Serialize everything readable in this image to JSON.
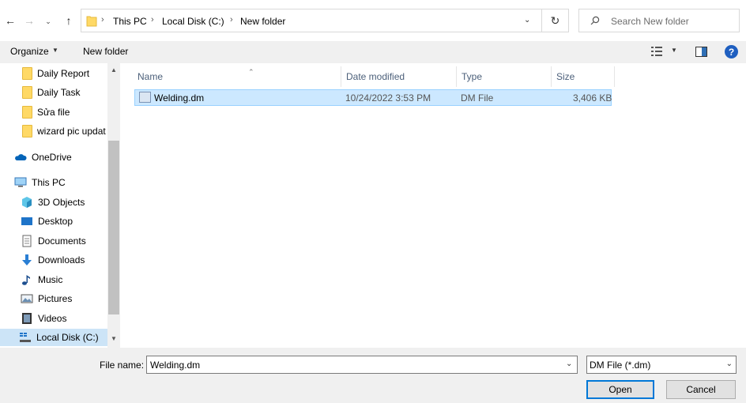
{
  "address_bar": {
    "crumbs": [
      "This PC",
      "Local Disk (C:)",
      "New folder"
    ],
    "search_placeholder": "Search New folder"
  },
  "command_bar": {
    "organize_label": "Organize",
    "new_folder_label": "New folder"
  },
  "nav_pane": {
    "items": [
      {
        "label": "Daily Report",
        "icon": "folder-icon"
      },
      {
        "label": "Daily Task",
        "icon": "folder-icon"
      },
      {
        "label": "Sửa file",
        "icon": "folder-icon"
      },
      {
        "label": "wizard pic updat",
        "icon": "folder-icon"
      },
      {
        "label": "OneDrive",
        "icon": "cloud-icon"
      },
      {
        "label": "This PC",
        "icon": "computer-icon"
      },
      {
        "label": "3D Objects",
        "icon": "cube-icon"
      },
      {
        "label": "Desktop",
        "icon": "desktop-icon"
      },
      {
        "label": "Documents",
        "icon": "document-icon"
      },
      {
        "label": "Downloads",
        "icon": "download-icon"
      },
      {
        "label": "Music",
        "icon": "music-icon"
      },
      {
        "label": "Pictures",
        "icon": "pictures-icon"
      },
      {
        "label": "Videos",
        "icon": "videos-icon"
      },
      {
        "label": "Local Disk (C:)",
        "icon": "drive-icon"
      }
    ]
  },
  "file_list": {
    "columns": [
      "Name",
      "Date modified",
      "Type",
      "Size"
    ],
    "rows": [
      {
        "name": "Welding.dm",
        "date": "10/24/2022 3:53 PM",
        "type": "DM File",
        "size": "3,406 KB"
      }
    ]
  },
  "bottom": {
    "file_name_label": "File name:",
    "file_name_value": "Welding.dm",
    "file_type": "DM File (*.dm)",
    "open_label": "Open",
    "cancel_label": "Cancel"
  },
  "colors": {
    "selection": "#cce8ff",
    "nav_selection": "#cce4f7",
    "accent": "#0078d7"
  }
}
